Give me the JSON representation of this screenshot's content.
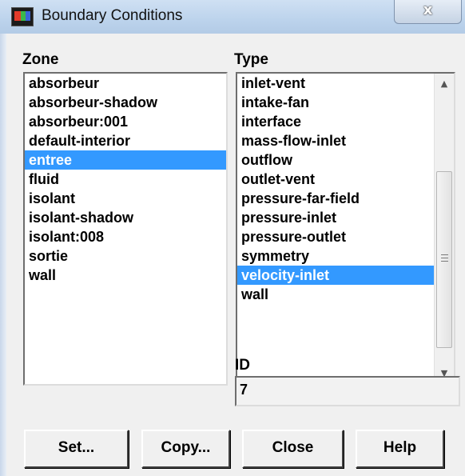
{
  "window": {
    "title": "Boundary Conditions",
    "close_glyph": "x"
  },
  "zone": {
    "label": "Zone",
    "items": [
      "absorbeur",
      "absorbeur-shadow",
      "absorbeur:001",
      "default-interior",
      "entree",
      "fluid",
      "isolant",
      "isolant-shadow",
      "isolant:008",
      "sortie",
      "wall"
    ],
    "selected": "entree"
  },
  "type": {
    "label": "Type",
    "items": [
      "inlet-vent",
      "intake-fan",
      "interface",
      "mass-flow-inlet",
      "outflow",
      "outlet-vent",
      "pressure-far-field",
      "pressure-inlet",
      "pressure-outlet",
      "symmetry",
      "velocity-inlet",
      "wall"
    ],
    "selected": "velocity-inlet"
  },
  "id": {
    "label": "ID",
    "value": "7"
  },
  "buttons": {
    "set": "Set...",
    "copy": "Copy...",
    "close": "Close",
    "help": "Help"
  },
  "icons": {
    "app": "fluent-app-icon",
    "close": "close-icon",
    "scroll_up": "scroll-up-icon",
    "scroll_down": "scroll-down-icon"
  },
  "colors": {
    "selection": "#3399ff",
    "titlebar": "#bcd3ec"
  }
}
